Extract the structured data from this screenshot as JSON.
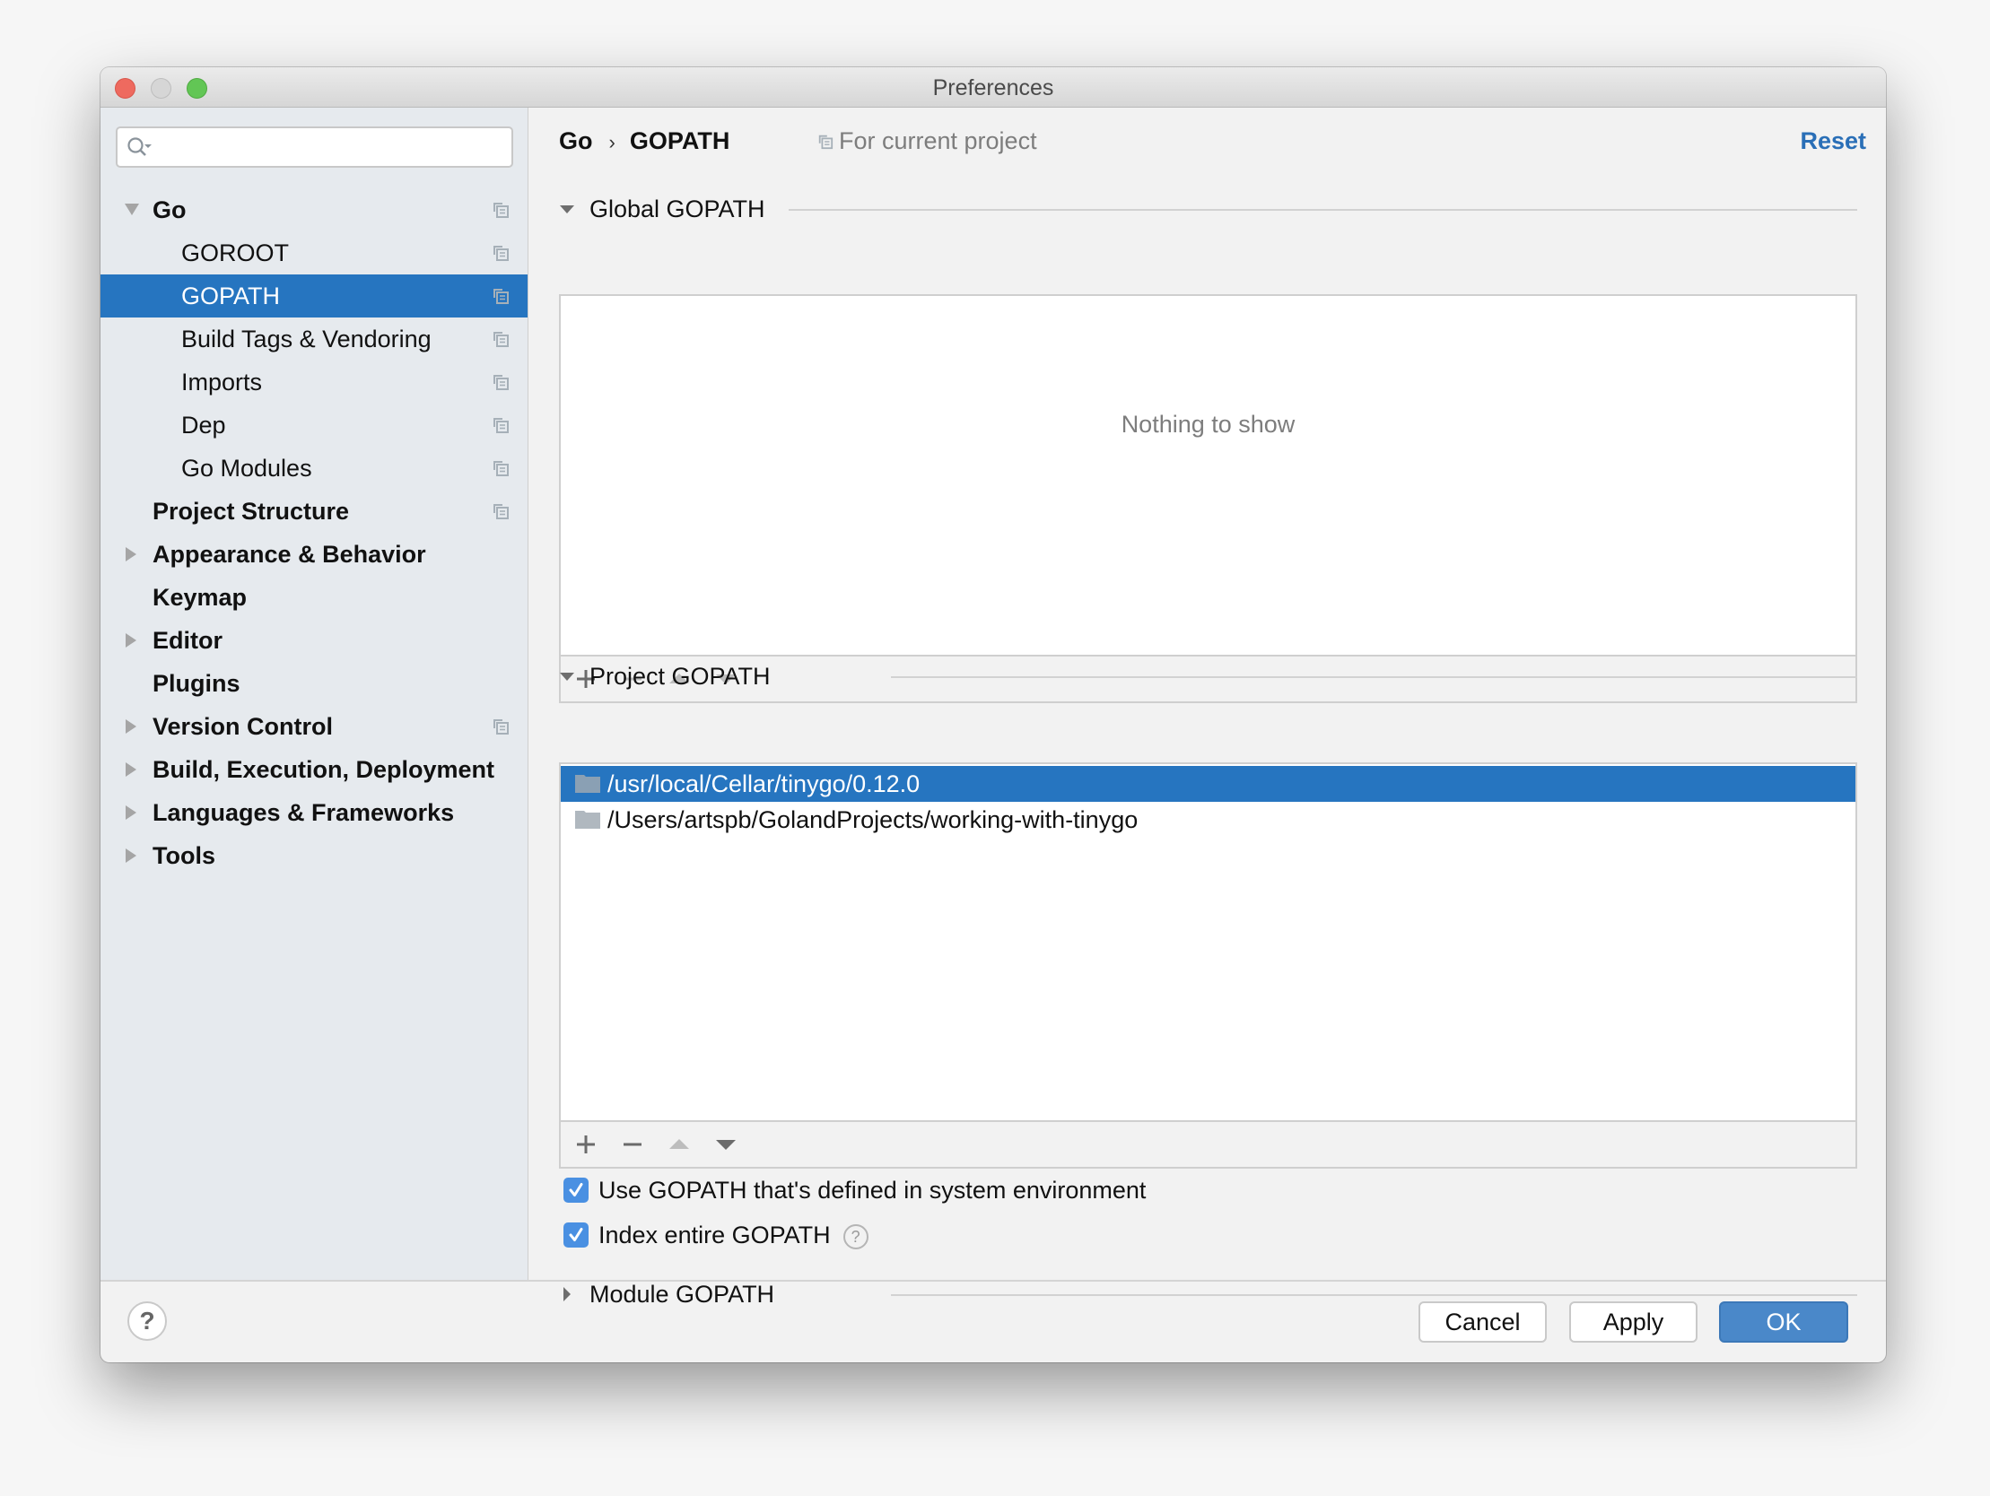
{
  "window": {
    "title": "Preferences"
  },
  "sidebar": {
    "search": {
      "placeholder": "",
      "value": ""
    },
    "items": [
      {
        "label": "Go",
        "bold": true,
        "expander": "expanded",
        "level": 0,
        "project_scope_icon": true,
        "selected": false
      },
      {
        "label": "GOROOT",
        "bold": false,
        "expander": "none",
        "level": 1,
        "project_scope_icon": true,
        "selected": false
      },
      {
        "label": "GOPATH",
        "bold": false,
        "expander": "none",
        "level": 1,
        "project_scope_icon": true,
        "selected": true
      },
      {
        "label": "Build Tags & Vendoring",
        "bold": false,
        "expander": "none",
        "level": 1,
        "project_scope_icon": true,
        "selected": false
      },
      {
        "label": "Imports",
        "bold": false,
        "expander": "none",
        "level": 1,
        "project_scope_icon": true,
        "selected": false
      },
      {
        "label": "Dep",
        "bold": false,
        "expander": "none",
        "level": 1,
        "project_scope_icon": true,
        "selected": false
      },
      {
        "label": "Go Modules",
        "bold": false,
        "expander": "none",
        "level": 1,
        "project_scope_icon": true,
        "selected": false
      },
      {
        "label": "Project Structure",
        "bold": true,
        "expander": "none",
        "level": 0,
        "project_scope_icon": true,
        "selected": false
      },
      {
        "label": "Appearance & Behavior",
        "bold": true,
        "expander": "collapsed",
        "level": 0,
        "project_scope_icon": false,
        "selected": false
      },
      {
        "label": "Keymap",
        "bold": true,
        "expander": "none",
        "level": 0,
        "project_scope_icon": false,
        "selected": false
      },
      {
        "label": "Editor",
        "bold": true,
        "expander": "collapsed",
        "level": 0,
        "project_scope_icon": false,
        "selected": false
      },
      {
        "label": "Plugins",
        "bold": true,
        "expander": "none",
        "level": 0,
        "project_scope_icon": false,
        "selected": false
      },
      {
        "label": "Version Control",
        "bold": true,
        "expander": "collapsed",
        "level": 0,
        "project_scope_icon": true,
        "selected": false
      },
      {
        "label": "Build, Execution, Deployment",
        "bold": true,
        "expander": "collapsed",
        "level": 0,
        "project_scope_icon": false,
        "selected": false
      },
      {
        "label": "Languages & Frameworks",
        "bold": true,
        "expander": "collapsed",
        "level": 0,
        "project_scope_icon": false,
        "selected": false
      },
      {
        "label": "Tools",
        "bold": true,
        "expander": "collapsed",
        "level": 0,
        "project_scope_icon": false,
        "selected": false
      }
    ]
  },
  "main": {
    "breadcrumb": [
      "Go",
      "GOPATH"
    ],
    "breadcrumb_separator": "›",
    "scope_label": "For current project",
    "reset_label": "Reset",
    "global_gopath": {
      "title": "Global GOPATH",
      "expanded": true,
      "empty_text": "Nothing to show",
      "entries": [],
      "toolbar": {
        "add": "+",
        "remove": "−",
        "move_up": "▲",
        "move_down": "▼"
      }
    },
    "project_gopath": {
      "title": "Project GOPATH",
      "expanded": true,
      "entries": [
        {
          "path": "/usr/local/Cellar/tinygo/0.12.0",
          "selected": true
        },
        {
          "path": "/Users/artspb/GolandProjects/working-with-tinygo",
          "selected": false
        }
      ],
      "toolbar": {
        "add": "+",
        "remove": "−",
        "move_up": "▲",
        "move_down": "▼"
      }
    },
    "options": [
      {
        "label": "Use GOPATH that's defined in system environment",
        "checked": true,
        "help": false
      },
      {
        "label": "Index entire GOPATH",
        "checked": true,
        "help": true
      }
    ],
    "help_glyph": "?",
    "module_gopath": {
      "title": "Module GOPATH",
      "expanded": false
    }
  },
  "footer": {
    "help_glyph": "?",
    "cancel_label": "Cancel",
    "apply_label": "Apply",
    "ok_label": "OK"
  },
  "colors": {
    "selection": "#2675c0",
    "link": "#2a6fb7",
    "primary_button": "#4a88c9",
    "checkbox": "#4a90e2",
    "sidebar_bg": "#e6eaee"
  }
}
